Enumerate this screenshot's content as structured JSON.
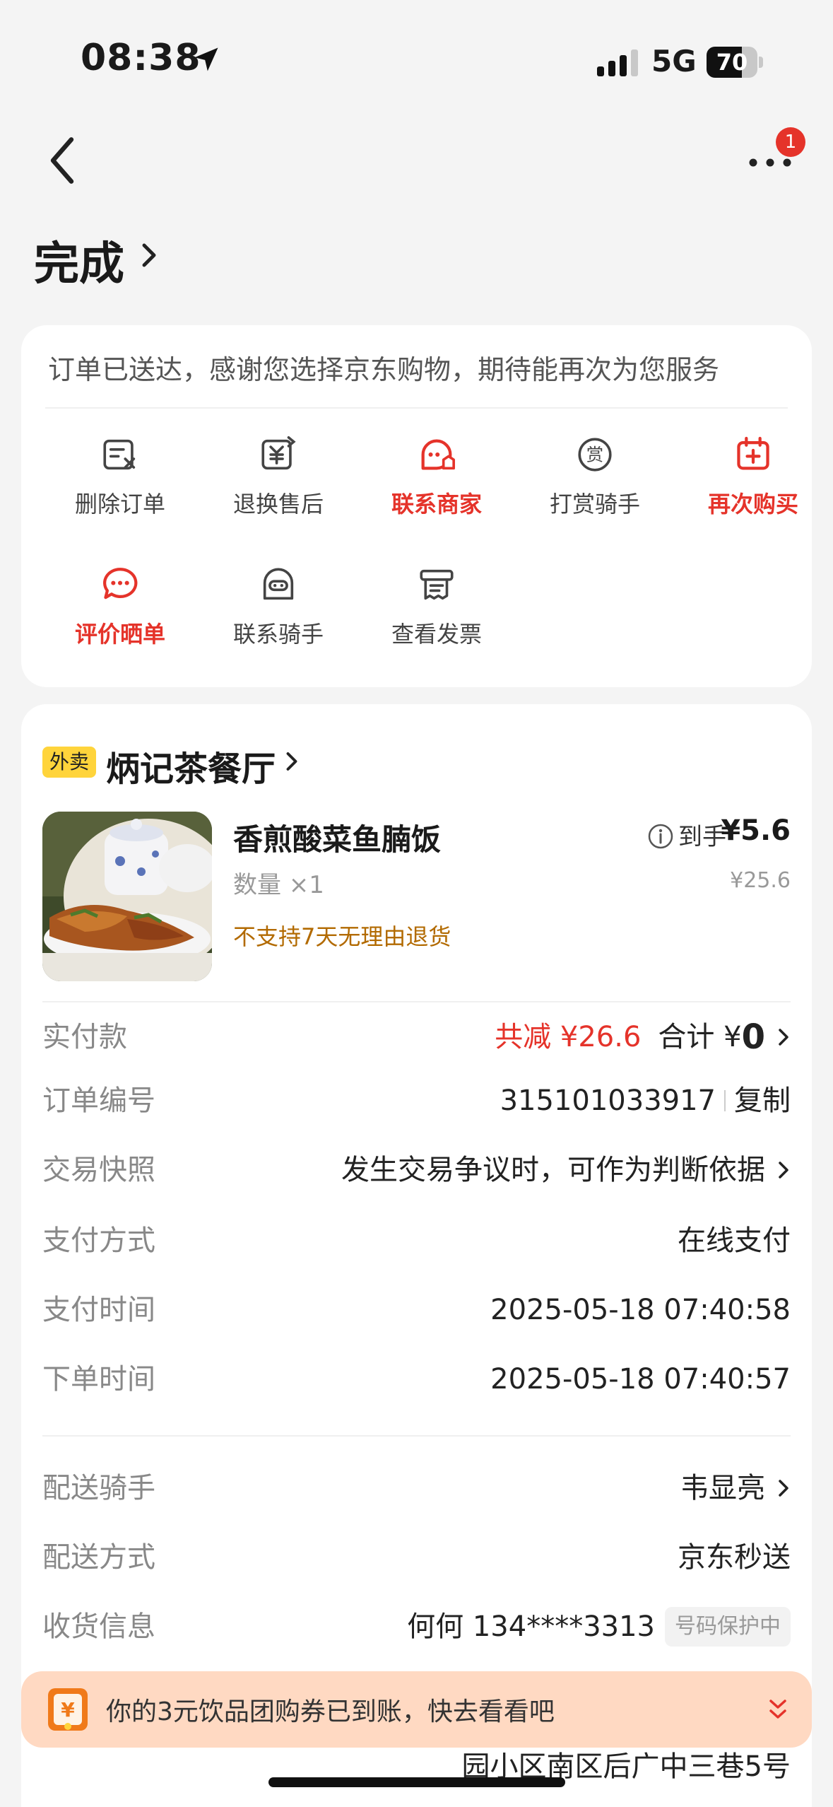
{
  "status_bar": {
    "time": "08:38",
    "network": "5G",
    "battery": "70",
    "battery_level": 0.7
  },
  "nav": {
    "more_badge": "1"
  },
  "page": {
    "title": "完成"
  },
  "action_card": {
    "notice": "订单已送达，感谢您选择京东购物，期待能再次为您服务",
    "actions": [
      {
        "label": "删除订单",
        "icon": "delete-order-icon"
      },
      {
        "label": "退换售后",
        "icon": "after-sale-icon"
      },
      {
        "label": "联系商家",
        "icon": "contact-merchant-icon"
      },
      {
        "label": "打赏骑手",
        "icon": "tip-rider-icon"
      },
      {
        "label": "再次购买",
        "icon": "buy-again-icon"
      },
      {
        "label": "评价晒单",
        "icon": "review-icon"
      },
      {
        "label": "联系骑手",
        "icon": "contact-rider-icon"
      },
      {
        "label": "查看发票",
        "icon": "invoice-icon"
      }
    ],
    "highlight_color": "#e5332a"
  },
  "order": {
    "tag": "外卖",
    "shop_name": "炳记茶餐厅",
    "item": {
      "name": "香煎酸菜鱼腩饭",
      "qty": "数量 ×1",
      "policy": "不支持7天无理由退货",
      "price_label": "到手",
      "price": "¥5.6",
      "orig_price": "¥25.6"
    },
    "rows": {
      "paid_label": "实付款",
      "paid_discount": "共减 ¥26.6",
      "paid_total_label": "合计 ¥",
      "paid_total": "0",
      "order_no_label": "订单编号",
      "order_no": "315101033917",
      "copy_label": "复制",
      "snapshot_label": "交易快照",
      "snapshot_value": "发生交易争议时，可作为判断依据",
      "pay_method_label": "支付方式",
      "pay_method": "在线支付",
      "pay_time_label": "支付时间",
      "pay_time": "2025-05-18 07:40:58",
      "order_time_label": "下单时间",
      "order_time": "2025-05-18 07:40:57",
      "rider_label": "配送骑手",
      "rider": "韦显亮",
      "delivery_label": "配送方式",
      "delivery": "京东秒送",
      "receiver_label": "收货信息",
      "receiver": "何何 134****3313",
      "protect_tag": "号码保护中",
      "address_partial": "园小区南区后广中三巷5号"
    }
  },
  "banner": {
    "text": "你的3元饮品团购券已到账，快去看看吧"
  }
}
